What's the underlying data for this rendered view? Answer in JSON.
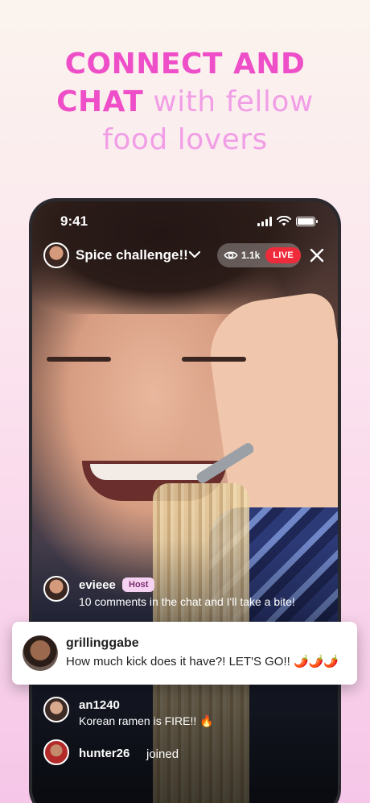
{
  "headline": {
    "line1": "CONNECT AND",
    "line2_strong": "CHAT",
    "line2_soft": "with fellow",
    "line3": "food lovers"
  },
  "status_bar": {
    "time": "9:41"
  },
  "stream": {
    "title": "Spice challenge!!",
    "viewer_count": "1.1k",
    "live_label": "LIVE"
  },
  "chat": [
    {
      "user": "evieee",
      "badge": "Host",
      "message": "10 comments in the chat and I'll take a bite!"
    },
    {
      "user": "grillinggabe",
      "message": "How much kick does it have?! LET'S GO!! 🌶️🌶️🌶️"
    },
    {
      "user": "an1240",
      "message": "Korean ramen is FIRE!! 🔥"
    },
    {
      "user": "hunter26",
      "message": "joined"
    }
  ],
  "colors": {
    "headline_strong": "#ee4fc8",
    "headline_soft": "#f19ee6",
    "live_red": "#ee2a3b",
    "host_badge_bg": "#f6d2f2"
  },
  "icons": [
    "signal-icon",
    "wifi-icon",
    "battery-icon",
    "chevron-down-icon",
    "eye-icon",
    "close-icon"
  ]
}
